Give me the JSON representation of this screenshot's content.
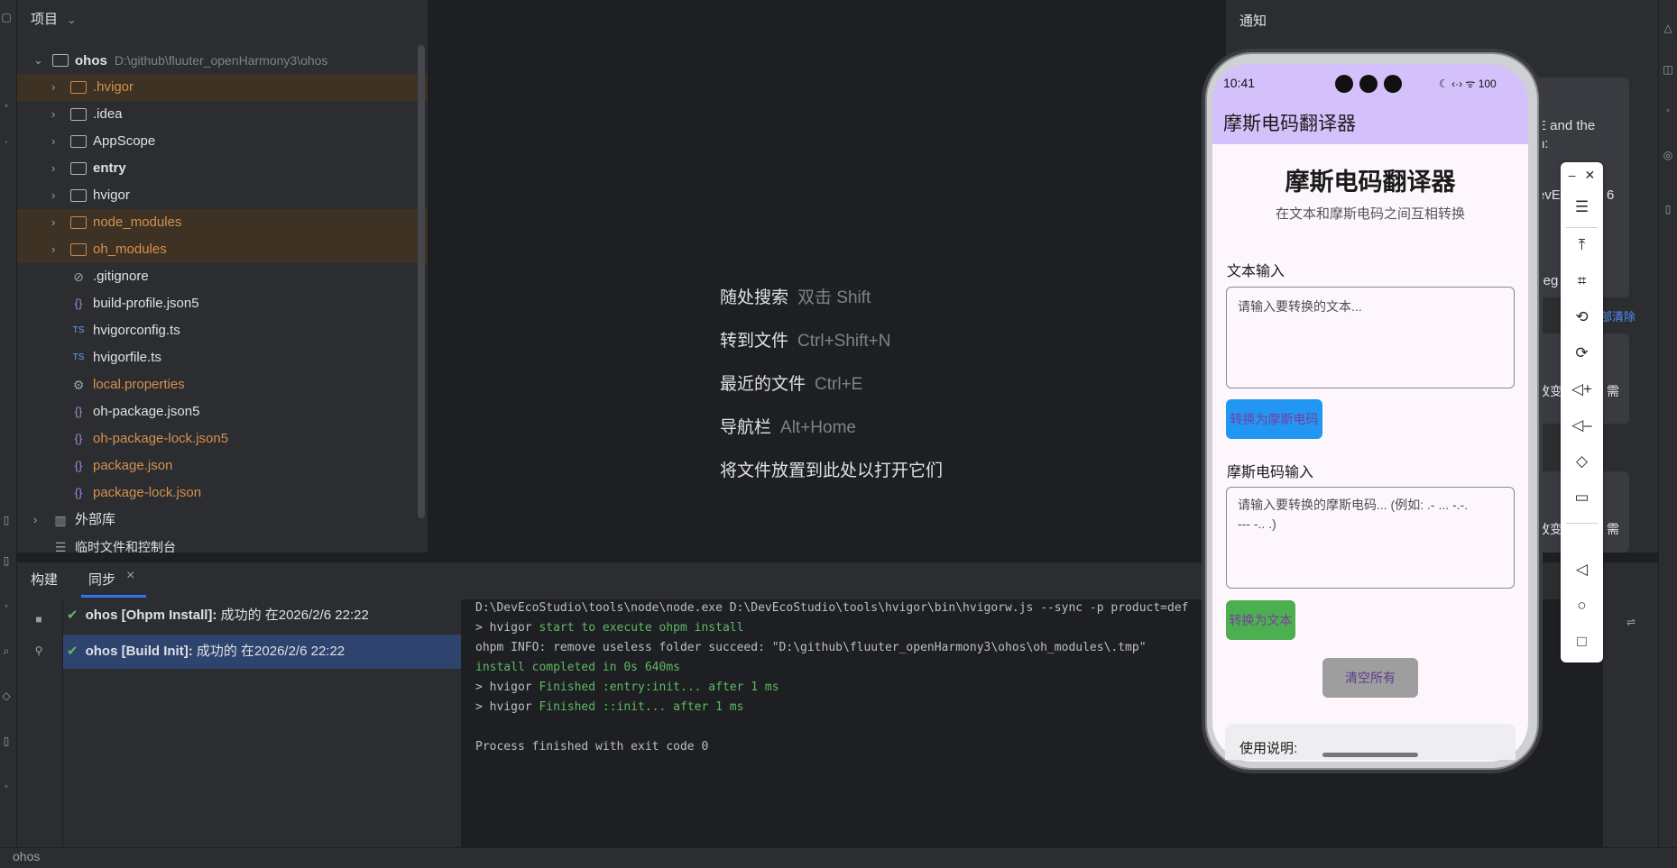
{
  "project": {
    "header": "项目",
    "root": {
      "name": "ohos",
      "path": "D:\\github\\fluuter_openHarmony3\\ohos"
    },
    "items": [
      {
        "label": ".hvigor",
        "type": "folder",
        "orange": true
      },
      {
        "label": ".idea",
        "type": "folder",
        "orange": false
      },
      {
        "label": "AppScope",
        "type": "folder",
        "orange": false
      },
      {
        "label": "entry",
        "type": "module",
        "orange": false
      },
      {
        "label": "hvigor",
        "type": "folder",
        "orange": false
      },
      {
        "label": "node_modules",
        "type": "folder",
        "orange": true
      },
      {
        "label": "oh_modules",
        "type": "folder",
        "orange": true
      },
      {
        "label": ".gitignore",
        "type": "ignore-file",
        "orange": false
      },
      {
        "label": "build-profile.json5",
        "type": "json",
        "orange": false
      },
      {
        "label": "hvigorconfig.ts",
        "type": "ts",
        "orange": false
      },
      {
        "label": "hvigorfile.ts",
        "type": "ts",
        "orange": false
      },
      {
        "label": "local.properties",
        "type": "settings",
        "orange": true
      },
      {
        "label": "oh-package.json5",
        "type": "json",
        "orange": false
      },
      {
        "label": "oh-package-lock.json5",
        "type": "json",
        "orange": true
      },
      {
        "label": "package.json",
        "type": "json",
        "orange": true
      },
      {
        "label": "package-lock.json",
        "type": "json",
        "orange": true
      }
    ],
    "external_libs": "外部库",
    "scratches": "临时文件和控制台"
  },
  "editor_hints": [
    {
      "label": "随处搜索",
      "key": "双击 Shift"
    },
    {
      "label": "转到文件",
      "key": "Ctrl+Shift+N"
    },
    {
      "label": "最近的文件",
      "key": "Ctrl+E"
    },
    {
      "label": "导航栏",
      "key": "Alt+Home"
    },
    {
      "label": "将文件放置到此处以打开它们",
      "key": ""
    }
  ],
  "notifications": {
    "title": "通知",
    "clear_all": "部清除",
    "fragments": [
      "E and the",
      "n:",
      "evEco",
      "6",
      "ileg",
      "改变",
      "需",
      "改变",
      "需"
    ]
  },
  "build": {
    "tabs": {
      "build": "构建",
      "sync": "同步"
    },
    "items": [
      {
        "title": "ohos [Ohpm Install]:",
        "status": "成功的 在2026/2/6 22:22",
        "selected": false
      },
      {
        "title": "ohos [Build Init]:",
        "status": "成功的 在2026/2/6 22:22",
        "selected": true
      }
    ],
    "console": [
      {
        "plain": "D:\\DevEcoStudio\\tools\\node\\node.exe D:\\DevEcoStudio\\tools\\hvigor\\bin\\hvigorw.js --sync -p product=def",
        "green": ""
      },
      {
        "plain": "> hvigor ",
        "green": "start to execute ohpm install"
      },
      {
        "plain": "ohpm INFO: remove useless folder succeed: \"D:\\github\\fluuter_openHarmony3\\ohos\\oh_modules\\.tmp\"",
        "green": ""
      },
      {
        "plain": "",
        "green": "install completed in 0s 640ms"
      },
      {
        "plain": "> hvigor ",
        "green": "Finished :entry:init... after 1 ms"
      },
      {
        "plain": "> hvigor ",
        "green": "Finished ::init... after 1 ms"
      },
      {
        "plain": "",
        "green": ""
      },
      {
        "plain": "Process finished with exit code 0",
        "green": ""
      }
    ]
  },
  "status_bar": {
    "project": "ohos"
  },
  "phone": {
    "time": "10:41",
    "sys_icons": "☾ ‹·› ᯤ 100",
    "app_title": "摩斯电码翻译器",
    "heading": "摩斯电码翻译器",
    "subheading": "在文本和摩斯电码之间互相转换",
    "text_label": "文本输入",
    "text_placeholder": "请输入要转换的文本...",
    "to_morse_button": "转换为摩斯电码",
    "morse_label": "摩斯电码输入",
    "morse_placeholder_line1": "请输入要转换的摩斯电码... (例如: .- ... -.-.",
    "morse_placeholder_line2": "--- -.. .)",
    "to_text_button": "转换为文本",
    "clear_button": "清空所有",
    "help_title": "使用说明:"
  },
  "colors": {
    "accent": "#3574f0",
    "app_bar": "#d4c0fb",
    "morse_button": "#2196f3",
    "text_button": "#4caf50",
    "clear_button": "#9e9e9e"
  }
}
